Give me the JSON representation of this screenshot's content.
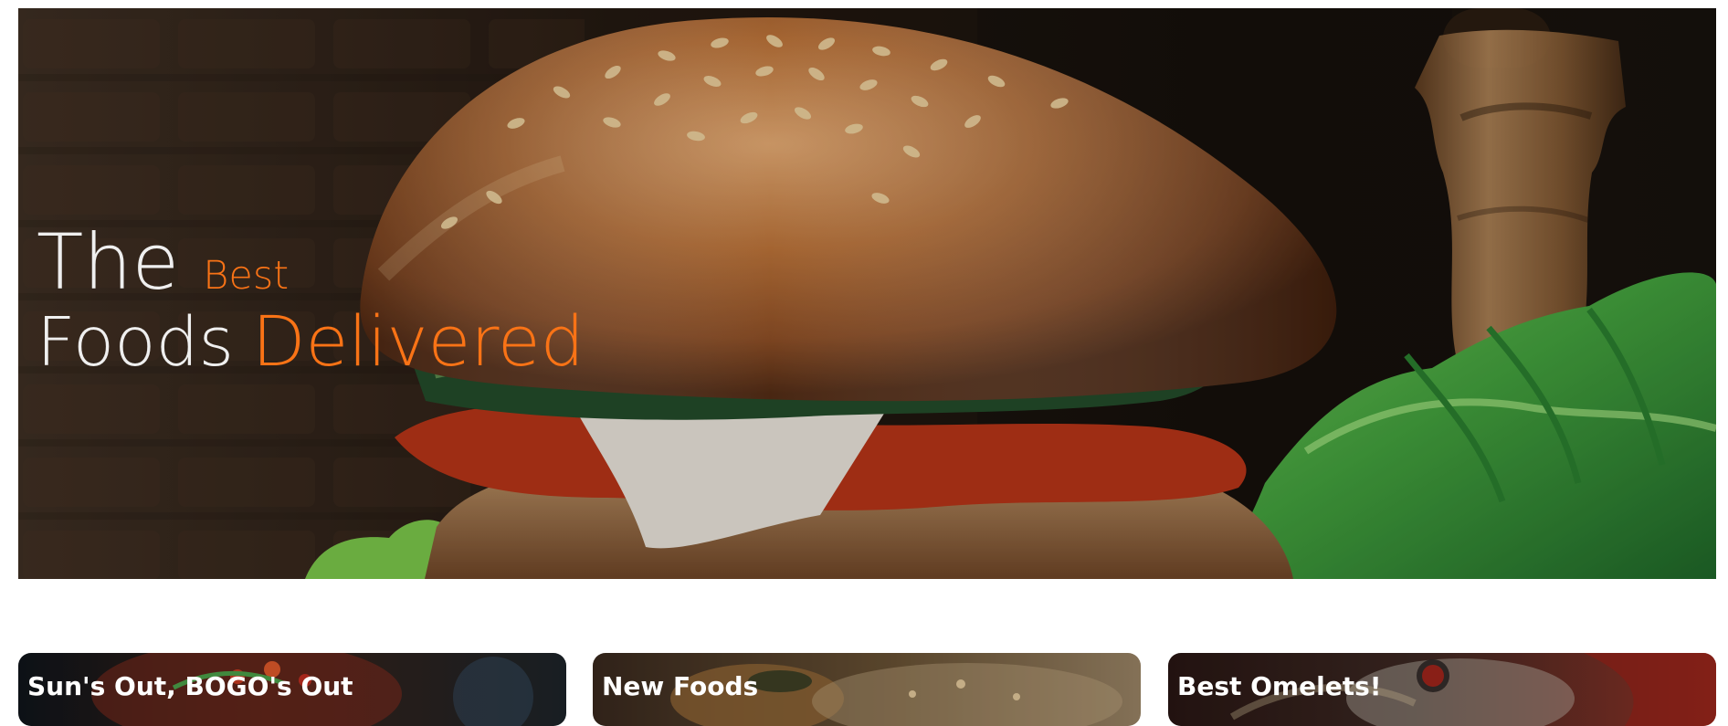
{
  "hero": {
    "line_one": {
      "the": "The",
      "best": "Best"
    },
    "line_two": {
      "foods": "Foods",
      "delivered": "Delivered"
    },
    "accent_color": "#f97316",
    "image_subject": "burger-hero-image"
  },
  "promos": [
    {
      "title": "Sun's Out, BOGO's Out",
      "image_subject": "salad-plate-image"
    },
    {
      "title": "New Foods",
      "image_subject": "fried-food-image"
    },
    {
      "title": "Best Omelets!",
      "image_subject": "omelet-dish-image"
    }
  ]
}
